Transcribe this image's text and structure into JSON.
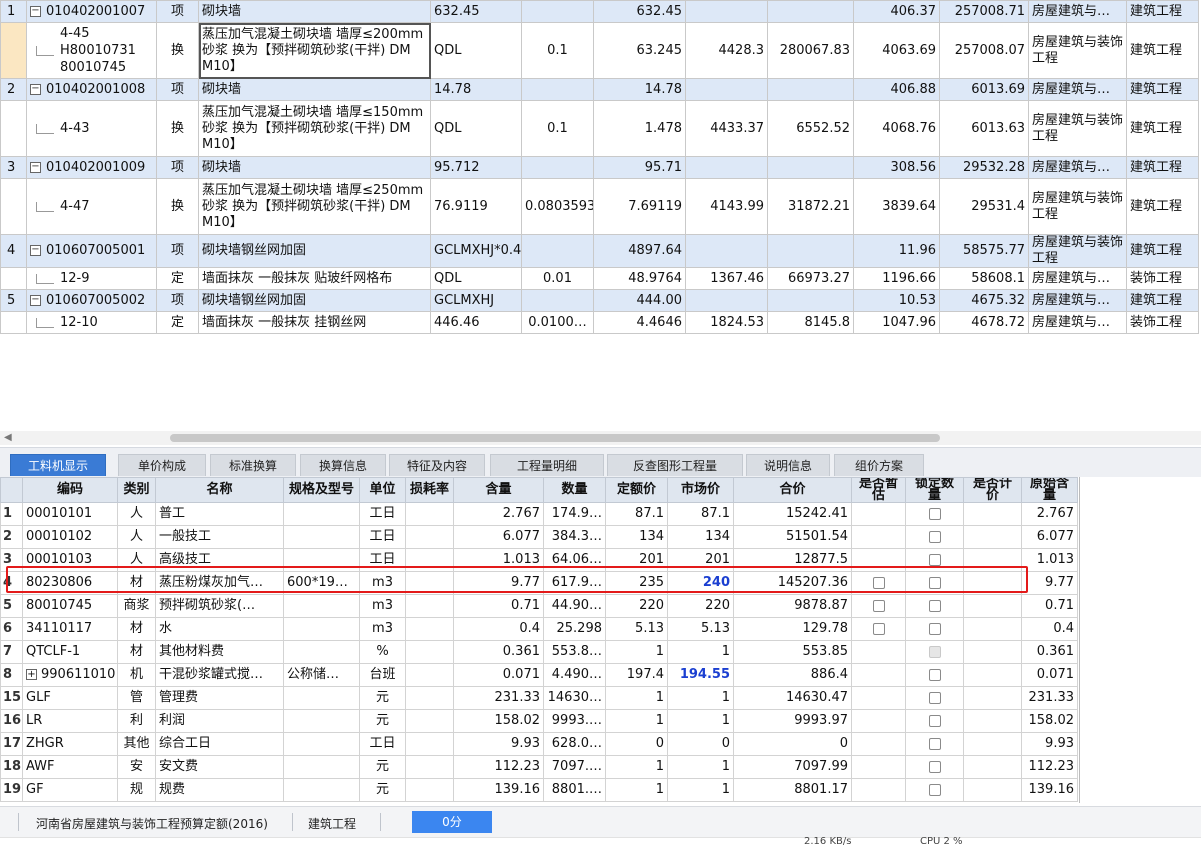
{
  "top_rows": [
    {
      "kind": "item",
      "row": "1",
      "code": "010402001007",
      "type": "项",
      "name": "砌块墙",
      "expr": "632.45",
      "coef": "",
      "qty": "632.45",
      "unit_price": "",
      "total": "",
      "comp_price": "406.37",
      "comp_total": "257008.71",
      "prof": "房屋建筑与…",
      "major": "建筑工程"
    },
    {
      "kind": "sub",
      "row": "",
      "code_lines": [
        "4-45",
        "H80010731",
        "80010745"
      ],
      "type": "换",
      "name": "蒸压加气混凝土砌块墙 墙厚≤200mm 砂浆 换为【预拌砌筑砂浆(干拌) DM M10】",
      "expr": "QDL",
      "coef": "0.1",
      "qty": "63.245",
      "unit_price": "4428.3",
      "total": "280067.83",
      "comp_price": "4063.69",
      "comp_total": "257008.07",
      "prof": "房屋建筑与装饰工程",
      "major": "建筑工程"
    },
    {
      "kind": "item",
      "row": "2",
      "code": "010402001008",
      "type": "项",
      "name": "砌块墙",
      "expr": "14.78",
      "coef": "",
      "qty": "14.78",
      "unit_price": "",
      "total": "",
      "comp_price": "406.88",
      "comp_total": "6013.69",
      "prof": "房屋建筑与…",
      "major": "建筑工程"
    },
    {
      "kind": "sub",
      "row": "",
      "code_lines": [
        "4-43"
      ],
      "type": "换",
      "name": "蒸压加气混凝土砌块墙 墙厚≤150mm 砂浆 换为【预拌砌筑砂浆(干拌) DM M10】",
      "expr": "QDL",
      "coef": "0.1",
      "qty": "1.478",
      "unit_price": "4433.37",
      "total": "6552.52",
      "comp_price": "4068.76",
      "comp_total": "6013.63",
      "prof": "房屋建筑与装饰工程",
      "major": "建筑工程"
    },
    {
      "kind": "item",
      "row": "3",
      "code": "010402001009",
      "type": "项",
      "name": "砌块墙",
      "expr": "95.712",
      "coef": "",
      "qty": "95.71",
      "unit_price": "",
      "total": "",
      "comp_price": "308.56",
      "comp_total": "29532.28",
      "prof": "房屋建筑与…",
      "major": "建筑工程"
    },
    {
      "kind": "sub",
      "row": "",
      "code_lines": [
        "4-47"
      ],
      "type": "换",
      "name": "蒸压加气混凝土砌块墙 墙厚≤250mm 砂浆 换为【预拌砌筑砂浆(干拌) DM M10】",
      "expr": "76.9119",
      "coef": "0.0803593",
      "qty": "7.69119",
      "unit_price": "4143.99",
      "total": "31872.21",
      "comp_price": "3839.64",
      "comp_total": "29531.4",
      "prof": "房屋建筑与装饰工程",
      "major": "建筑工程"
    },
    {
      "kind": "item",
      "row": "4",
      "code": "010607005001",
      "type": "项",
      "name": "砌块墙钢丝网加固",
      "expr": "GCLMXHJ*0.4",
      "coef": "",
      "qty": "4897.64",
      "unit_price": "",
      "total": "",
      "comp_price": "11.96",
      "comp_total": "58575.77",
      "prof": "房屋建筑与装饰工程",
      "major": "建筑工程"
    },
    {
      "kind": "sub1",
      "row": "",
      "code_lines": [
        "12-9"
      ],
      "type": "定",
      "name": "墙面抹灰 一般抹灰 贴玻纤网格布",
      "expr": "QDL",
      "coef": "0.01",
      "qty": "48.9764",
      "unit_price": "1367.46",
      "total": "66973.27",
      "comp_price": "1196.66",
      "comp_total": "58608.1",
      "prof": "房屋建筑与…",
      "major": "装饰工程"
    },
    {
      "kind": "item",
      "row": "5",
      "code": "010607005002",
      "type": "项",
      "name": "砌块墙钢丝网加固",
      "expr": "GCLMXHJ",
      "coef": "",
      "qty": "444.00",
      "unit_price": "",
      "total": "",
      "comp_price": "10.53",
      "comp_total": "4675.32",
      "prof": "房屋建筑与…",
      "major": "建筑工程"
    },
    {
      "kind": "sub1",
      "row": "",
      "code_lines": [
        "12-10"
      ],
      "type": "定",
      "name": "墙面抹灰 一般抹灰 挂钢丝网",
      "expr": "446.46",
      "coef": "0.0100…",
      "qty": "4.4646",
      "unit_price": "1824.53",
      "total": "8145.8",
      "comp_price": "1047.96",
      "comp_total": "4678.72",
      "prof": "房屋建筑与…",
      "major": "装饰工程"
    }
  ],
  "tabs": [
    "工料机显示",
    "单价构成",
    "标准换算",
    "换算信息",
    "特征及内容",
    "工程量明细",
    "反查图形工程量",
    "说明信息",
    "组价方案"
  ],
  "active_tab": 0,
  "bottom_headers": [
    "",
    "编码",
    "类别",
    "名称",
    "规格及型号",
    "单位",
    "损耗率",
    "含量",
    "数量",
    "定额价",
    "市场价",
    "合价",
    "是否暂估",
    "锁定数量",
    "是否计价",
    "原始含量"
  ],
  "bottom_rows": [
    {
      "rn": "1",
      "code": "00010101",
      "cat": "人",
      "name": "普工",
      "spec": "",
      "unit": "工日",
      "loss": "",
      "content": "2.767",
      "qty": "174.9…",
      "quota": "87.1",
      "market": "87.1",
      "total": "15242.41",
      "est": "",
      "lock": "box",
      "price": "",
      "orig": "2.767"
    },
    {
      "rn": "2",
      "code": "00010102",
      "cat": "人",
      "name": "一般技工",
      "spec": "",
      "unit": "工日",
      "loss": "",
      "content": "6.077",
      "qty": "384.3…",
      "quota": "134",
      "market": "134",
      "total": "51501.54",
      "est": "",
      "lock": "box",
      "price": "",
      "orig": "6.077"
    },
    {
      "rn": "3",
      "code": "00010103",
      "cat": "人",
      "name": "高级技工",
      "spec": "",
      "unit": "工日",
      "loss": "",
      "content": "1.013",
      "qty": "64.06…",
      "quota": "201",
      "market": "201",
      "total": "12877.5",
      "est": "",
      "lock": "box",
      "price": "",
      "orig": "1.013"
    },
    {
      "rn": "4",
      "code": "80230806",
      "cat": "材",
      "name": "蒸压粉煤灰加气…",
      "spec": "600*19…",
      "unit": "m3",
      "loss": "",
      "content": "9.77",
      "qty": "617.9…",
      "quota": "235",
      "market": "240",
      "market_blue": true,
      "total": "145207.36",
      "est": "box",
      "lock": "box",
      "price": "",
      "orig": "9.77"
    },
    {
      "rn": "5",
      "code": "80010745",
      "cat": "商浆",
      "name": "预拌砌筑砂浆(…",
      "spec": "",
      "unit": "m3",
      "loss": "",
      "content": "0.71",
      "qty": "44.90…",
      "quota": "220",
      "market": "220",
      "total": "9878.87",
      "est": "box",
      "lock": "box",
      "price": "",
      "orig": "0.71"
    },
    {
      "rn": "6",
      "code": "34110117",
      "cat": "材",
      "name": "水",
      "spec": "",
      "unit": "m3",
      "loss": "",
      "content": "0.4",
      "qty": "25.298",
      "quota": "5.13",
      "market": "5.13",
      "total": "129.78",
      "est": "box",
      "lock": "box",
      "price": "",
      "orig": "0.4"
    },
    {
      "rn": "7",
      "code": "QTCLF-1",
      "cat": "材",
      "name": "其他材料费",
      "spec": "",
      "unit": "%",
      "loss": "",
      "content": "0.361",
      "qty": "553.8…",
      "quota": "1",
      "market": "1",
      "total": "553.85",
      "est": "",
      "lock": "dis",
      "price": "",
      "orig": "0.361"
    },
    {
      "rn": "8",
      "code": "990611010",
      "plus": true,
      "cat": "机",
      "name": "干混砂浆罐式搅…",
      "spec": "公称储…",
      "unit": "台班",
      "loss": "",
      "content": "0.071",
      "qty": "4.490…",
      "quota": "197.4",
      "market": "194.55",
      "market_blue": true,
      "total": "886.4",
      "est": "",
      "lock": "box",
      "price": "",
      "orig": "0.071"
    },
    {
      "rn": "15",
      "code": "GLF",
      "cat": "管",
      "name": "管理费",
      "spec": "",
      "unit": "元",
      "loss": "",
      "content": "231.33",
      "qty": "14630…",
      "quota": "1",
      "market": "1",
      "total": "14630.47",
      "est": "",
      "lock": "box",
      "price": "",
      "orig": "231.33"
    },
    {
      "rn": "16",
      "code": "LR",
      "cat": "利",
      "name": "利润",
      "spec": "",
      "unit": "元",
      "loss": "",
      "content": "158.02",
      "qty": "9993.…",
      "quota": "1",
      "market": "1",
      "total": "9993.97",
      "est": "",
      "lock": "box",
      "price": "",
      "orig": "158.02"
    },
    {
      "rn": "17",
      "code": "ZHGR",
      "cat": "其他",
      "name": "综合工日",
      "spec": "",
      "unit": "工日",
      "loss": "",
      "content": "9.93",
      "qty": "628.0…",
      "quota": "0",
      "market": "0",
      "total": "0",
      "est": "",
      "lock": "box",
      "price": "",
      "orig": "9.93"
    },
    {
      "rn": "18",
      "code": "AWF",
      "cat": "安",
      "name": "安文费",
      "spec": "",
      "unit": "元",
      "loss": "",
      "content": "112.23",
      "qty": "7097.…",
      "quota": "1",
      "market": "1",
      "total": "7097.99",
      "est": "",
      "lock": "box",
      "price": "",
      "orig": "112.23"
    },
    {
      "rn": "19",
      "code": "GF",
      "cat": "规",
      "name": "规费",
      "spec": "",
      "unit": "元",
      "loss": "",
      "content": "139.16",
      "qty": "8801.…",
      "quota": "1",
      "market": "1",
      "total": "8801.17",
      "est": "",
      "lock": "box",
      "price": "",
      "orig": "139.16"
    }
  ],
  "status": {
    "quota_library": "河南省房屋建筑与装饰工程预算定额(2016)",
    "discipline": "建筑工程",
    "score": "0分",
    "net_speed": "2.16 KB/s",
    "cpu": "CPU 2 %"
  },
  "colors": {
    "item_row_bg": "#dde8f7",
    "active_tab": "#3a7bd5",
    "highlight": "#e31a1a",
    "market_price_changed": "#1b3fd1"
  }
}
